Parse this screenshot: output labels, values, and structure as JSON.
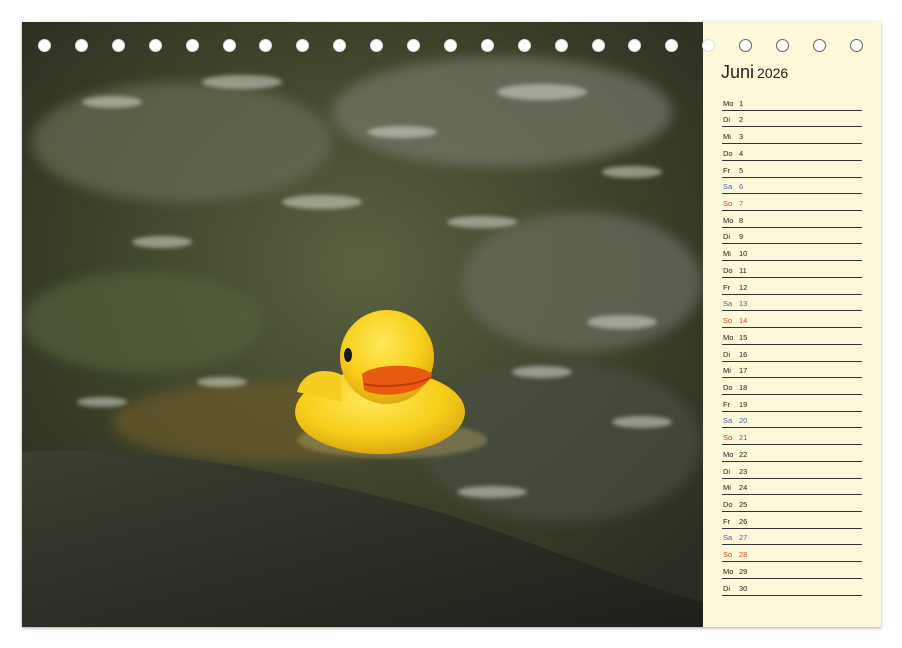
{
  "calendar": {
    "month": "Juni",
    "year": "2026",
    "colors": {
      "saturday": "#4a5fa8",
      "sunday": "#c84a2a",
      "panel": "#fdf8d9"
    },
    "days": [
      {
        "wd": "Mo",
        "d": "1",
        "type": "weekday"
      },
      {
        "wd": "Di",
        "d": "2",
        "type": "weekday"
      },
      {
        "wd": "Mi",
        "d": "3",
        "type": "weekday"
      },
      {
        "wd": "Do",
        "d": "4",
        "type": "weekday"
      },
      {
        "wd": "Fr",
        "d": "5",
        "type": "weekday"
      },
      {
        "wd": "Sa",
        "d": "6",
        "type": "sat"
      },
      {
        "wd": "So",
        "d": "7",
        "type": "sun"
      },
      {
        "wd": "Mo",
        "d": "8",
        "type": "weekday"
      },
      {
        "wd": "Di",
        "d": "9",
        "type": "weekday"
      },
      {
        "wd": "Mi",
        "d": "10",
        "type": "weekday"
      },
      {
        "wd": "Do",
        "d": "11",
        "type": "weekday"
      },
      {
        "wd": "Fr",
        "d": "12",
        "type": "weekday"
      },
      {
        "wd": "Sa",
        "d": "13",
        "type": "sat"
      },
      {
        "wd": "So",
        "d": "14",
        "type": "sun"
      },
      {
        "wd": "Mo",
        "d": "15",
        "type": "weekday"
      },
      {
        "wd": "Di",
        "d": "16",
        "type": "weekday"
      },
      {
        "wd": "Mi",
        "d": "17",
        "type": "weekday"
      },
      {
        "wd": "Do",
        "d": "18",
        "type": "weekday"
      },
      {
        "wd": "Fr",
        "d": "19",
        "type": "weekday"
      },
      {
        "wd": "Sa",
        "d": "20",
        "type": "sat"
      },
      {
        "wd": "So",
        "d": "21",
        "type": "sun"
      },
      {
        "wd": "Mo",
        "d": "22",
        "type": "weekday"
      },
      {
        "wd": "Di",
        "d": "23",
        "type": "weekday"
      },
      {
        "wd": "Mi",
        "d": "24",
        "type": "weekday"
      },
      {
        "wd": "Do",
        "d": "25",
        "type": "weekday"
      },
      {
        "wd": "Fr",
        "d": "26",
        "type": "weekday"
      },
      {
        "wd": "Sa",
        "d": "27",
        "type": "sat"
      },
      {
        "wd": "So",
        "d": "28",
        "type": "sun"
      },
      {
        "wd": "Mo",
        "d": "29",
        "type": "weekday"
      },
      {
        "wd": "Di",
        "d": "30",
        "type": "weekday"
      }
    ]
  }
}
